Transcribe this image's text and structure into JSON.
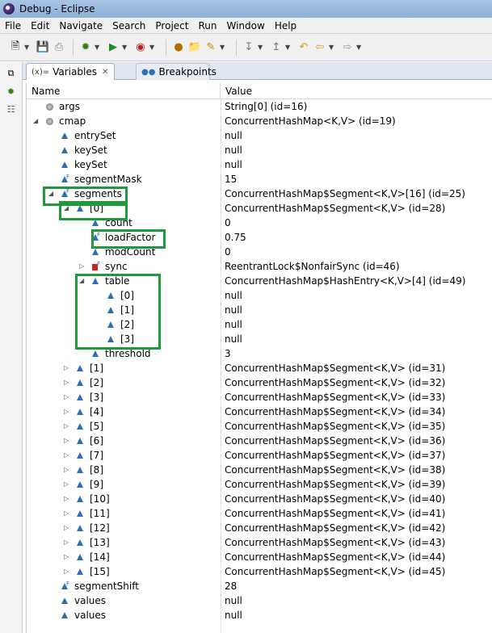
{
  "window": {
    "title": "Debug - Eclipse"
  },
  "menu": [
    "File",
    "Edit",
    "Navigate",
    "Search",
    "Project",
    "Run",
    "Window",
    "Help"
  ],
  "toolbar": {
    "icons": [
      "new-icon",
      "save-icon",
      "print-icon",
      "debug-icon",
      "run-icon",
      "run-external-icon",
      "open-type-icon",
      "open-folder-icon",
      "pen-icon",
      "next-annotation-icon",
      "prev-annotation-icon",
      "last-edit-icon",
      "back-icon",
      "forward-icon"
    ]
  },
  "tabs": {
    "variables_label": "Variables",
    "variables_prefix": "(x)=",
    "breakpoints_label": "Breakpoints"
  },
  "table": {
    "col_name": "Name",
    "col_value": "Value",
    "rows": [
      {
        "name": "args",
        "value": "String[0]  (id=16)",
        "level": 0,
        "twisty": "",
        "icon": "circ"
      },
      {
        "name": "cmap",
        "value": "ConcurrentHashMap<K,V>  (id=19)",
        "level": 0,
        "twisty": "open",
        "icon": "circ"
      },
      {
        "name": "entrySet",
        "value": "null",
        "level": 1,
        "twisty": "",
        "icon": "tri"
      },
      {
        "name": "keySet",
        "value": "null",
        "level": 1,
        "twisty": "",
        "icon": "tri"
      },
      {
        "name": "keySet",
        "value": "null",
        "level": 1,
        "twisty": "",
        "icon": "tri"
      },
      {
        "name": "segmentMask",
        "value": "15",
        "level": 1,
        "twisty": "",
        "icon": "tri",
        "final": true
      },
      {
        "name": "segments",
        "value": "ConcurrentHashMap$Segment<K,V>[16]  (id=25)",
        "level": 1,
        "twisty": "open",
        "icon": "tri",
        "final": true
      },
      {
        "name": "[0]",
        "value": "ConcurrentHashMap$Segment<K,V>  (id=28)",
        "level": 2,
        "twisty": "open",
        "icon": "tri"
      },
      {
        "name": "count",
        "value": "0",
        "level": 3,
        "twisty": "",
        "icon": "tri"
      },
      {
        "name": "loadFactor",
        "value": "0.75",
        "level": 3,
        "twisty": "",
        "icon": "tri",
        "final": true
      },
      {
        "name": "modCount",
        "value": "0",
        "level": 3,
        "twisty": "",
        "icon": "tri"
      },
      {
        "name": "sync",
        "value": "ReentrantLock$NonfairSync  (id=46)",
        "level": 3,
        "twisty": "closed",
        "icon": "sq",
        "final": true
      },
      {
        "name": "table",
        "value": "ConcurrentHashMap$HashEntry<K,V>[4]  (id=49)",
        "level": 3,
        "twisty": "open",
        "icon": "tri"
      },
      {
        "name": "[0]",
        "value": "null",
        "level": 4,
        "twisty": "",
        "icon": "tri"
      },
      {
        "name": "[1]",
        "value": "null",
        "level": 4,
        "twisty": "",
        "icon": "tri"
      },
      {
        "name": "[2]",
        "value": "null",
        "level": 4,
        "twisty": "",
        "icon": "tri"
      },
      {
        "name": "[3]",
        "value": "null",
        "level": 4,
        "twisty": "",
        "icon": "tri"
      },
      {
        "name": "threshold",
        "value": "3",
        "level": 3,
        "twisty": "",
        "icon": "tri"
      },
      {
        "name": "[1]",
        "value": "ConcurrentHashMap$Segment<K,V>  (id=31)",
        "level": 2,
        "twisty": "closed",
        "icon": "tri"
      },
      {
        "name": "[2]",
        "value": "ConcurrentHashMap$Segment<K,V>  (id=32)",
        "level": 2,
        "twisty": "closed",
        "icon": "tri"
      },
      {
        "name": "[3]",
        "value": "ConcurrentHashMap$Segment<K,V>  (id=33)",
        "level": 2,
        "twisty": "closed",
        "icon": "tri"
      },
      {
        "name": "[4]",
        "value": "ConcurrentHashMap$Segment<K,V>  (id=34)",
        "level": 2,
        "twisty": "closed",
        "icon": "tri"
      },
      {
        "name": "[5]",
        "value": "ConcurrentHashMap$Segment<K,V>  (id=35)",
        "level": 2,
        "twisty": "closed",
        "icon": "tri"
      },
      {
        "name": "[6]",
        "value": "ConcurrentHashMap$Segment<K,V>  (id=36)",
        "level": 2,
        "twisty": "closed",
        "icon": "tri"
      },
      {
        "name": "[7]",
        "value": "ConcurrentHashMap$Segment<K,V>  (id=37)",
        "level": 2,
        "twisty": "closed",
        "icon": "tri"
      },
      {
        "name": "[8]",
        "value": "ConcurrentHashMap$Segment<K,V>  (id=38)",
        "level": 2,
        "twisty": "closed",
        "icon": "tri"
      },
      {
        "name": "[9]",
        "value": "ConcurrentHashMap$Segment<K,V>  (id=39)",
        "level": 2,
        "twisty": "closed",
        "icon": "tri"
      },
      {
        "name": "[10]",
        "value": "ConcurrentHashMap$Segment<K,V>  (id=40)",
        "level": 2,
        "twisty": "closed",
        "icon": "tri"
      },
      {
        "name": "[11]",
        "value": "ConcurrentHashMap$Segment<K,V>  (id=41)",
        "level": 2,
        "twisty": "closed",
        "icon": "tri"
      },
      {
        "name": "[12]",
        "value": "ConcurrentHashMap$Segment<K,V>  (id=42)",
        "level": 2,
        "twisty": "closed",
        "icon": "tri"
      },
      {
        "name": "[13]",
        "value": "ConcurrentHashMap$Segment<K,V>  (id=43)",
        "level": 2,
        "twisty": "closed",
        "icon": "tri"
      },
      {
        "name": "[14]",
        "value": "ConcurrentHashMap$Segment<K,V>  (id=44)",
        "level": 2,
        "twisty": "closed",
        "icon": "tri"
      },
      {
        "name": "[15]",
        "value": "ConcurrentHashMap$Segment<K,V>  (id=45)",
        "level": 2,
        "twisty": "closed",
        "icon": "tri"
      },
      {
        "name": "segmentShift",
        "value": "28",
        "level": 1,
        "twisty": "",
        "icon": "tri",
        "final": true
      },
      {
        "name": "values",
        "value": "null",
        "level": 1,
        "twisty": "",
        "icon": "tri"
      },
      {
        "name": "values",
        "value": "null",
        "level": 1,
        "twisty": "",
        "icon": "tri"
      }
    ]
  },
  "colors": {
    "highlight": "#1f9a3a",
    "tri_icon": "#2c6fb3"
  }
}
